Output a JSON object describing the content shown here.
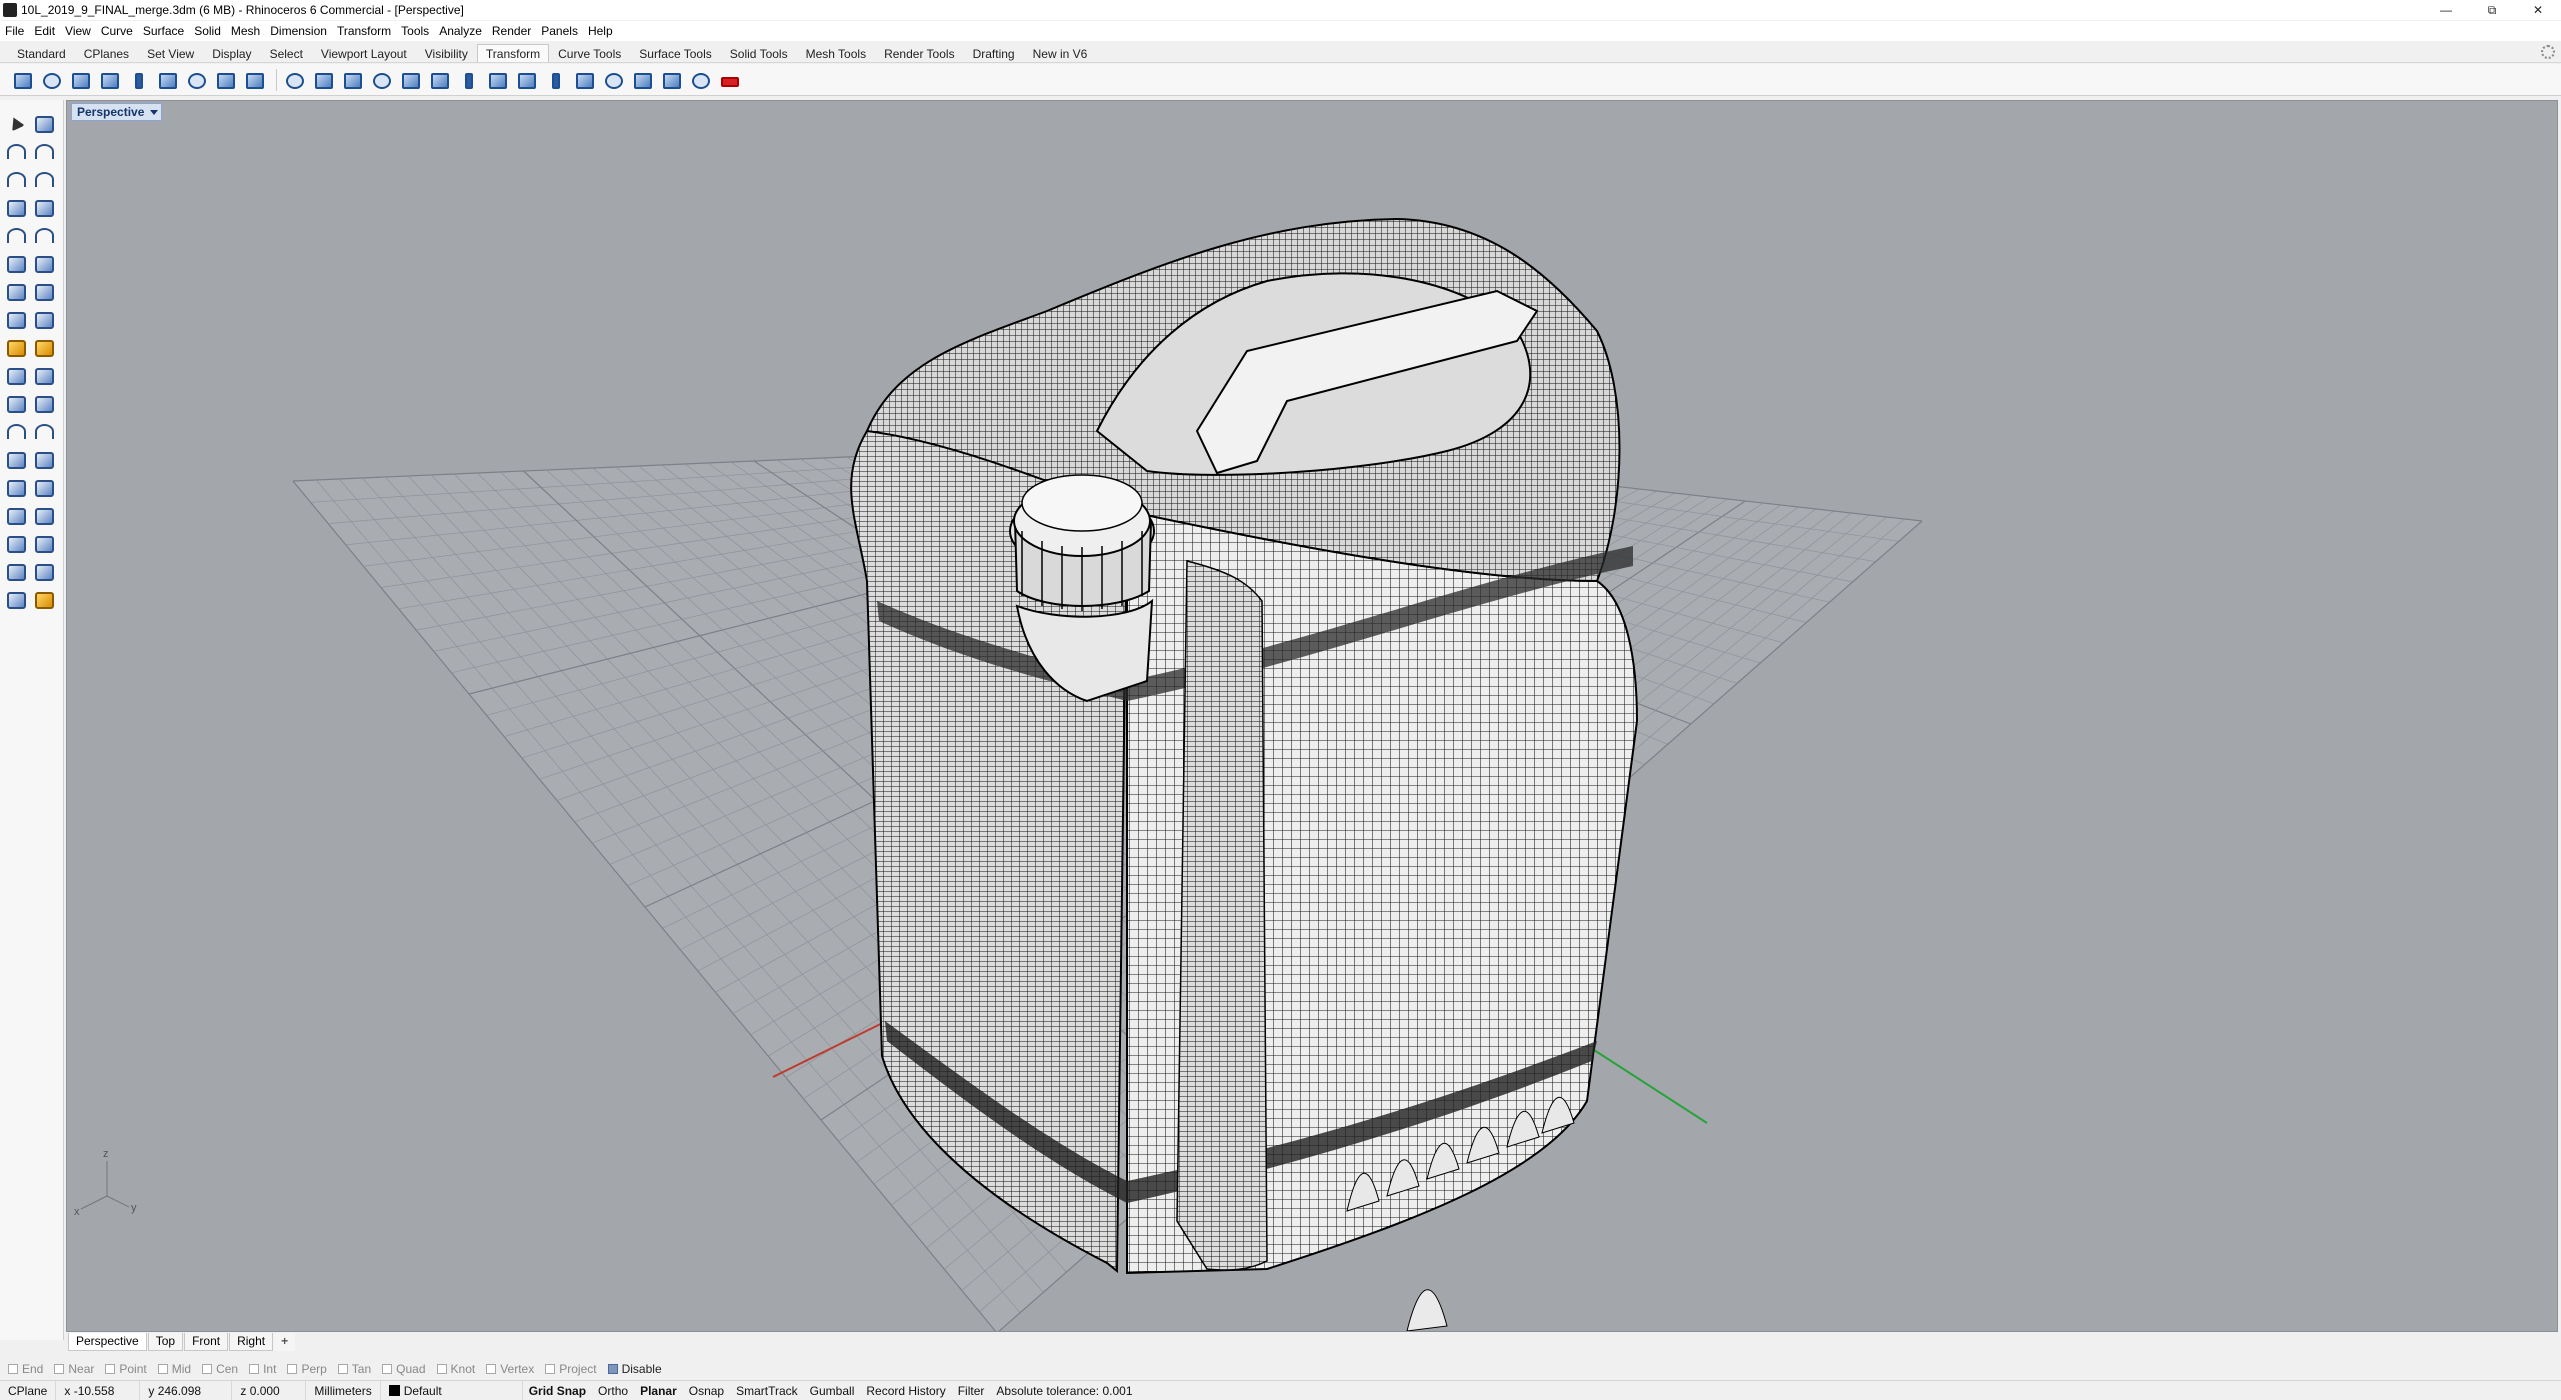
{
  "window": {
    "title": "10L_2019_9_FINAL_merge.3dm (6 MB) - Rhinoceros 6 Commercial - [Perspective]",
    "controls": [
      "minimize-icon",
      "restore-icon",
      "close-icon"
    ]
  },
  "menu": [
    "File",
    "Edit",
    "View",
    "Curve",
    "Surface",
    "Solid",
    "Mesh",
    "Dimension",
    "Transform",
    "Tools",
    "Analyze",
    "Render",
    "Panels",
    "Help"
  ],
  "toolbar_tabs": {
    "items": [
      "Standard",
      "CPlanes",
      "Set View",
      "Display",
      "Select",
      "Viewport Layout",
      "Visibility",
      "Transform",
      "Curve Tools",
      "Surface Tools",
      "Solid Tools",
      "Mesh Tools",
      "Render Tools",
      "Drafting",
      "New in V6"
    ],
    "active": "Transform"
  },
  "viewport": {
    "label": "Perspective",
    "axis_labels": {
      "x": "x",
      "y": "y",
      "z": "z"
    }
  },
  "viewport_tabs": {
    "items": [
      "Perspective",
      "Top",
      "Front",
      "Right"
    ],
    "active": "Perspective",
    "add": "+"
  },
  "osnap": [
    {
      "label": "End",
      "checked": false
    },
    {
      "label": "Near",
      "checked": false
    },
    {
      "label": "Point",
      "checked": false
    },
    {
      "label": "Mid",
      "checked": false
    },
    {
      "label": "Cen",
      "checked": false
    },
    {
      "label": "Int",
      "checked": false
    },
    {
      "label": "Perp",
      "checked": false
    },
    {
      "label": "Tan",
      "checked": false
    },
    {
      "label": "Quad",
      "checked": false
    },
    {
      "label": "Knot",
      "checked": false
    },
    {
      "label": "Vertex",
      "checked": false
    },
    {
      "label": "Project",
      "checked": false
    },
    {
      "label": "Disable",
      "checked": true
    }
  ],
  "status": {
    "cplane": "CPlane",
    "x": "x -10.558",
    "y": "y 246.098",
    "z": "z 0.000",
    "units": "Millimeters",
    "layer": "Default",
    "layer_color": "#000000",
    "panes": [
      "Grid Snap",
      "Ortho",
      "Planar",
      "Osnap",
      "SmartTrack",
      "Gumball",
      "Record History",
      "Filter"
    ],
    "bold_panes": [
      "Grid Snap",
      "Planar"
    ],
    "tolerance": "Absolute tolerance: 0.001"
  },
  "colors": {
    "viewport_bg": "#a3a6ab",
    "grid": "#8f9298",
    "x_axis": "#c0392b",
    "y_axis": "#27a33a",
    "accent": "#1d4e8f"
  }
}
